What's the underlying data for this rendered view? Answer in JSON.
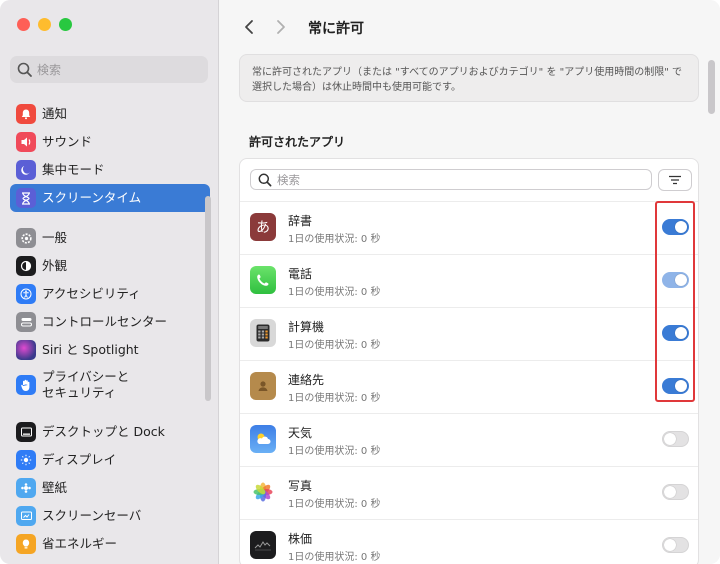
{
  "sidebar": {
    "search_placeholder": "検索",
    "items": [
      {
        "label": "通知",
        "icon": "bell-icon",
        "color": "#f04a3e"
      },
      {
        "label": "サウンド",
        "icon": "speaker-icon",
        "color": "#f04a5a"
      },
      {
        "label": "集中モード",
        "icon": "moon-icon",
        "color": "#5b5fd6"
      },
      {
        "label": "スクリーンタイム",
        "icon": "hourglass-icon",
        "color": "#5b5fd6",
        "active": true
      },
      {
        "label": "一般",
        "icon": "gear-icon",
        "color": "#8e8e93"
      },
      {
        "label": "外観",
        "icon": "appearance-icon",
        "color": "#1c1c1e"
      },
      {
        "label": "アクセシビリティ",
        "icon": "accessibility-icon",
        "color": "#2f7cf6"
      },
      {
        "label": "コントロールセンター",
        "icon": "control-center-icon",
        "color": "#8e8e93"
      },
      {
        "label": "Siri と Spotlight",
        "icon": "siri-icon",
        "color": "#3a3a8c"
      },
      {
        "label_line1": "プライバシーと",
        "label_line2": "セキュリティ",
        "icon": "hand-icon",
        "color": "#2f7cf6"
      },
      {
        "label": "デスクトップと Dock",
        "icon": "dock-icon",
        "color": "#1c1c1e"
      },
      {
        "label": "ディスプレイ",
        "icon": "display-icon",
        "color": "#2f7cf6"
      },
      {
        "label": "壁紙",
        "icon": "wallpaper-icon",
        "color": "#4fa8f0"
      },
      {
        "label": "スクリーンセーバ",
        "icon": "screensaver-icon",
        "color": "#4fa8f0"
      },
      {
        "label": "省エネルギー",
        "icon": "battery-icon",
        "color": "#f5a524"
      }
    ]
  },
  "header": {
    "back_label": "<",
    "forward_label": ">",
    "title": "常に許可"
  },
  "description": "常に許可されたアプリ（または \"すべてのアプリおよびカテゴリ\" を \"アプリ使用時間の制限\" で選択した場合）は休止時間中も使用可能です。",
  "section_title": "許可されたアプリ",
  "app_search_placeholder": "検索",
  "apps": [
    {
      "name": "辞書",
      "usage": "1日の使用状況: 0 秒",
      "icon": "dictionary-icon",
      "on": true
    },
    {
      "name": "電話",
      "usage": "1日の使用状況: 0 秒",
      "icon": "phone-icon",
      "on": true
    },
    {
      "name": "計算機",
      "usage": "1日の使用状況: 0 秒",
      "icon": "calculator-icon",
      "on": true
    },
    {
      "name": "連絡先",
      "usage": "1日の使用状況: 0 秒",
      "icon": "contacts-icon",
      "on": true
    },
    {
      "name": "天気",
      "usage": "1日の使用状況: 0 秒",
      "icon": "weather-icon",
      "on": false
    },
    {
      "name": "写真",
      "usage": "1日の使用状況: 0 秒",
      "icon": "photos-icon",
      "on": false
    },
    {
      "name": "株価",
      "usage": "1日の使用状況: 0 秒",
      "icon": "stocks-icon",
      "on": false
    }
  ],
  "colors": {
    "accent": "#3a7bd5",
    "highlight": "#e0383a"
  }
}
